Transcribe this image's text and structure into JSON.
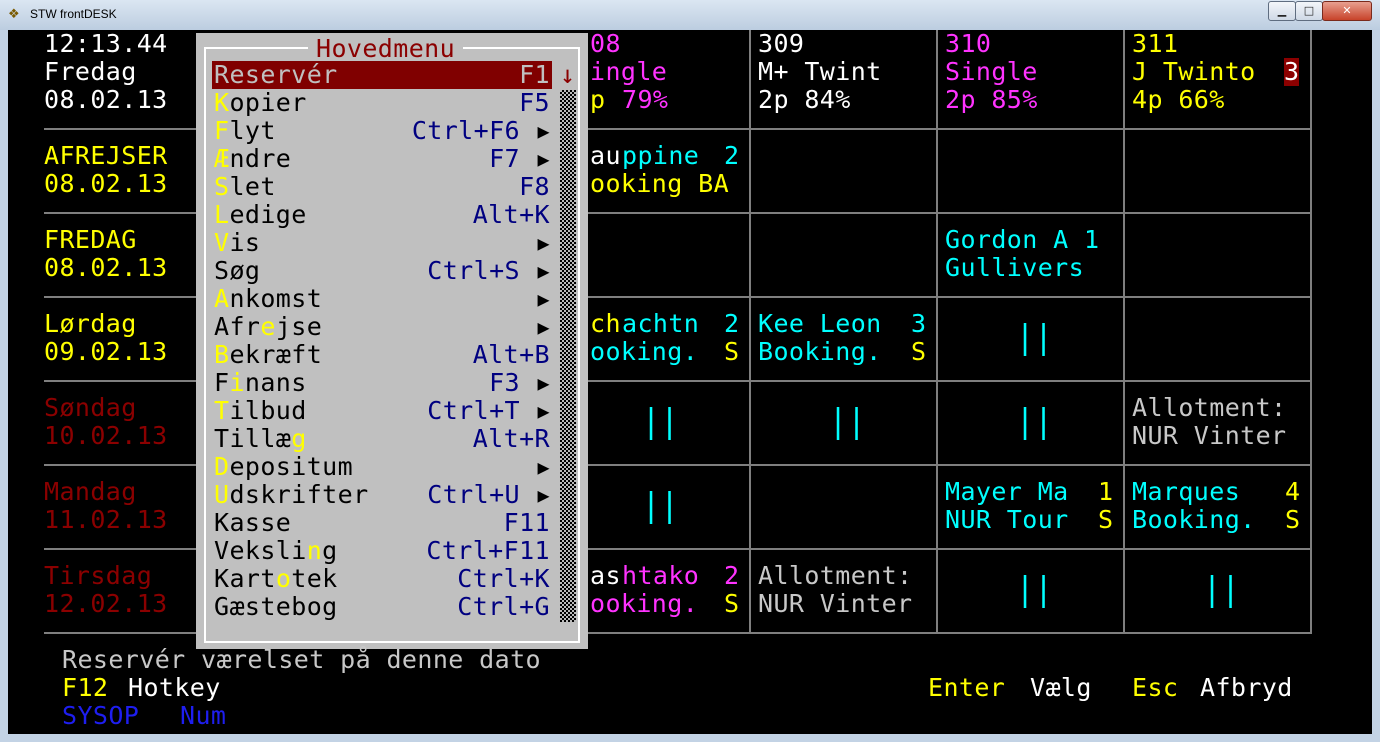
{
  "window": {
    "title": "STW frontDESK",
    "min": "▁",
    "max": "□",
    "close": "✕"
  },
  "clock": {
    "time": "12:13.44",
    "day": "Fredag",
    "date": "08.02.13"
  },
  "rooms": [
    {
      "num": "08",
      "type": "ingle",
      "occ_p": "p",
      "occ_pct": "79%"
    },
    {
      "num": "309",
      "type": "M+ Twint",
      "occ": "2p 84%"
    },
    {
      "num": "310",
      "type": "Single",
      "occ": "2p 85%"
    },
    {
      "num": "311",
      "type": "J Twinto",
      "badge": "3",
      "occ": "4p 66%"
    }
  ],
  "days": [
    {
      "line1": "AFREJSER",
      "line2": "08.02.13"
    },
    {
      "line1": "FREDAG",
      "line2": "08.02.13"
    },
    {
      "line1": "Lørdag",
      "line2": "09.02.13"
    },
    {
      "line1": "Søndag",
      "line2": "10.02.13"
    },
    {
      "line1": "Mandag",
      "line2": "11.02.13"
    },
    {
      "line1": "Tirsdag",
      "line2": "12.02.13"
    }
  ],
  "bookings": {
    "r1c1_a": "au",
    "r1c1_b": "ppine",
    "r1c1_n": "2",
    "r1c1_l2": "ooking BA",
    "r2c3_l1": "Gordon A 1",
    "r2c3_l2": "Gullivers",
    "r3c1_a": "ch",
    "r3c1_b": "achtn",
    "r3c1_n": "2",
    "r3c1_l2a": "ooking.",
    "r3c1_l2b": "S",
    "r3c2_l1": "Kee Leon",
    "r3c2_n": "3",
    "r3c2_l2a": "Booking.",
    "r3c2_l2b": "S",
    "r4c4_l1": "Allotment:",
    "r4c4_l2": "NUR Vinter",
    "r5c3_l1": "Mayer Ma",
    "r5c3_n": "1",
    "r5c3_l2a": "NUR Tour",
    "r5c3_l2b": "S",
    "r5c4_l1": "Marques",
    "r5c4_n": "4",
    "r5c4_l2a": "Booking.",
    "r5c4_l2b": "S",
    "r6c1_a": "as",
    "r6c1_b": "htako",
    "r6c1_n": "2",
    "r6c1_l2a": "ooking.",
    "r6c1_l2b": "S",
    "r6c2_l1": "Allotment:",
    "r6c2_l2": "NUR Vinter",
    "bars": "||"
  },
  "menu": {
    "title": "Hovedmenu",
    "arrow": "▶",
    "scroll_up": "↓",
    "items": [
      {
        "pre": "",
        "hk": "R",
        "post": "eservér",
        "key": "F1",
        "arrow": false
      },
      {
        "pre": "",
        "hk": "K",
        "post": "opier",
        "key": "F5",
        "arrow": false
      },
      {
        "pre": "",
        "hk": "F",
        "post": "lyt",
        "key": "Ctrl+F6",
        "arrow": true
      },
      {
        "pre": "",
        "hk": "Æ",
        "post": "ndre",
        "key": "F7",
        "arrow": true
      },
      {
        "pre": "",
        "hk": "S",
        "post": "let",
        "key": "F8",
        "arrow": false
      },
      {
        "pre": "",
        "hk": "L",
        "post": "edige",
        "key": "Alt+K",
        "arrow": false
      },
      {
        "pre": "",
        "hk": "V",
        "post": "is",
        "key": "",
        "arrow": true
      },
      {
        "pre": "Søg",
        "hk": "",
        "post": "",
        "key": "Ctrl+S",
        "arrow": true
      },
      {
        "pre": "",
        "hk": "A",
        "post": "nkomst",
        "key": "",
        "arrow": true
      },
      {
        "pre": "Afr",
        "hk": "e",
        "post": "jse",
        "key": "",
        "arrow": true
      },
      {
        "pre": "",
        "hk": "B",
        "post": "ekræft",
        "key": "Alt+B",
        "arrow": false
      },
      {
        "pre": "F",
        "hk": "i",
        "post": "nans",
        "key": "F3",
        "arrow": true
      },
      {
        "pre": "",
        "hk": "T",
        "post": "ilbud",
        "key": "Ctrl+T",
        "arrow": true
      },
      {
        "pre": "Tillæ",
        "hk": "g",
        "post": "",
        "key": "Alt+R",
        "arrow": false
      },
      {
        "pre": "",
        "hk": "D",
        "post": "epositum",
        "key": "",
        "arrow": true
      },
      {
        "pre": "",
        "hk": "U",
        "post": "dskrifter",
        "key": "Ctrl+U",
        "arrow": true
      },
      {
        "pre": "Kasse",
        "hk": "",
        "post": "",
        "key": "F11",
        "arrow": false
      },
      {
        "pre": "Veksli",
        "hk": "n",
        "post": "g",
        "key": "Ctrl+F11",
        "arrow": false
      },
      {
        "pre": "Kart",
        "hk": "o",
        "post": "tek",
        "key": "Ctrl+K",
        "arrow": false
      },
      {
        "pre": "Gæstebog",
        "hk": "",
        "post": "",
        "key": "Ctrl+G",
        "arrow": false
      }
    ]
  },
  "status": {
    "hint": "Reservér værelset på denne dato",
    "f12_key": "F12",
    "f12_label": "Hotkey",
    "enter_key": "Enter",
    "enter_label": "Vælg",
    "esc_key": "Esc",
    "esc_label": "Afbryd",
    "user": "SYSOP",
    "num": "Num"
  }
}
